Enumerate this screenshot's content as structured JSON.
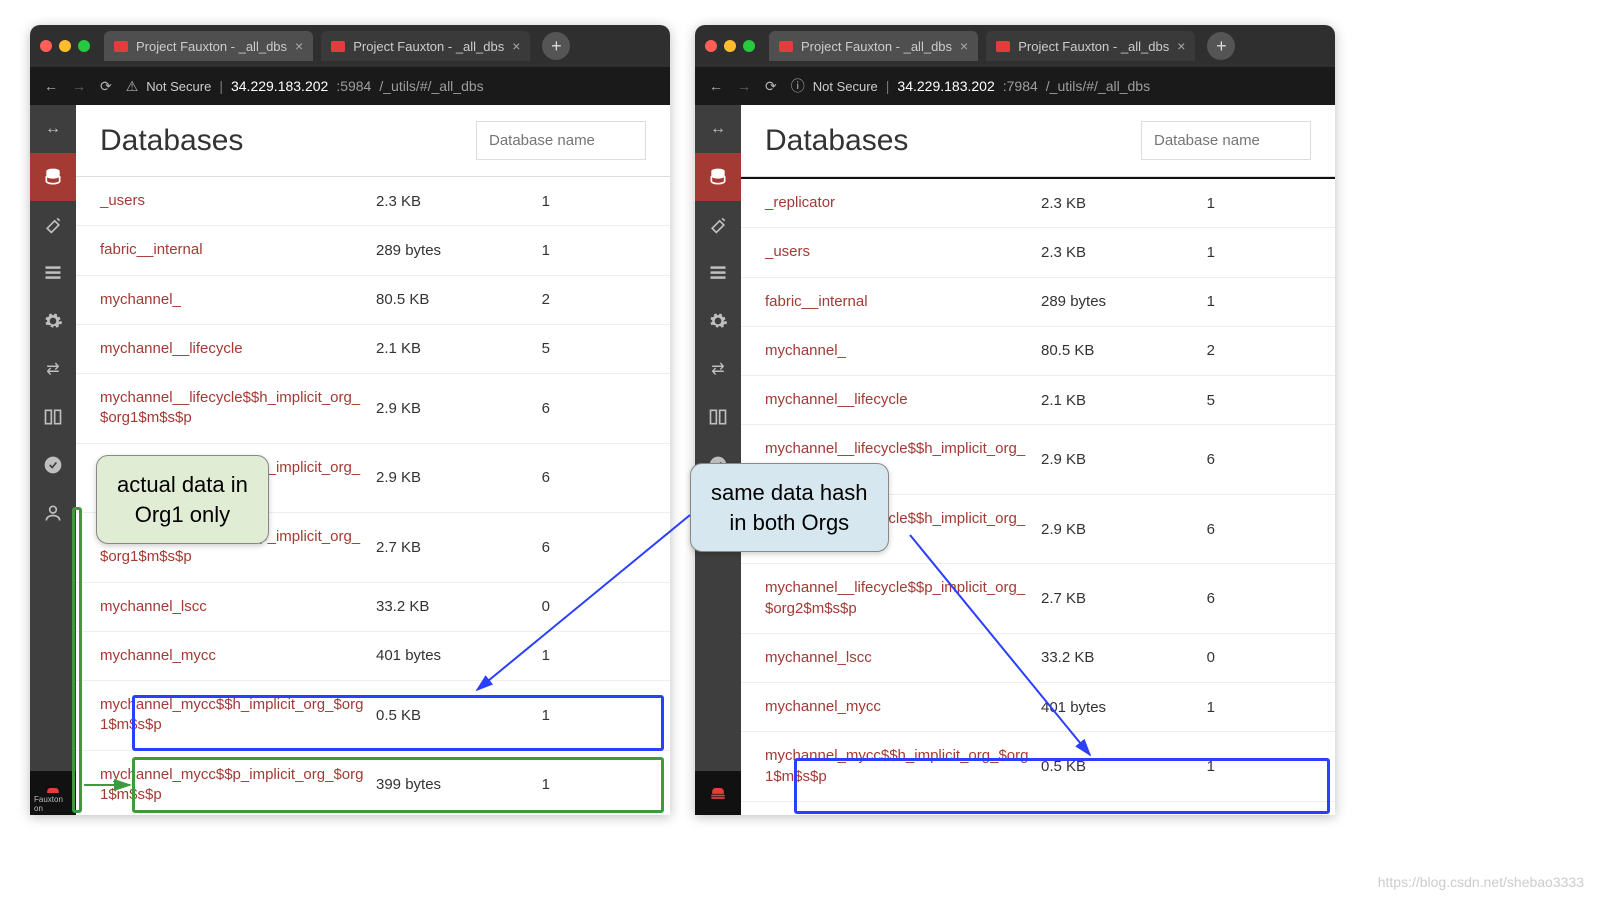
{
  "tabs": {
    "t1": "Project Fauxton - _all_dbs",
    "t2": "Project Fauxton - _all_dbs"
  },
  "notsecure": "Not Secure",
  "addr": {
    "left": {
      "host": "34.229.183.202",
      "port": ":5984",
      "path": "/_utils/#/_all_dbs"
    },
    "right": {
      "host": "34.229.183.202",
      "port": ":7984",
      "path": "/_utils/#/_all_dbs"
    }
  },
  "heading": "Databases",
  "search_ph": "Database name",
  "fx": "Fauxton on",
  "left_rows": [
    {
      "name": "_users",
      "size": "2.3 KB",
      "cnt": "1"
    },
    {
      "name": "fabric__internal",
      "size": "289 bytes",
      "cnt": "1"
    },
    {
      "name": "mychannel_",
      "size": "80.5 KB",
      "cnt": "2"
    },
    {
      "name": "mychannel__lifecycle",
      "size": "2.1 KB",
      "cnt": "5"
    },
    {
      "name": "mychannel__lifecycle$$h_implicit_org_$org1$m$s$p",
      "size": "2.9 KB",
      "cnt": "6"
    },
    {
      "name": "mychannel__lifecycle$$h_implicit_org_$org2$m$s$p",
      "size": "2.9 KB",
      "cnt": "6"
    },
    {
      "name": "mychannel__lifecycle$$p_implicit_org_$org1$m$s$p",
      "size": "2.7 KB",
      "cnt": "6"
    },
    {
      "name": "mychannel_lscc",
      "size": "33.2 KB",
      "cnt": "0"
    },
    {
      "name": "mychannel_mycc",
      "size": "401 bytes",
      "cnt": "1"
    },
    {
      "name": "mychannel_mycc$$h_implicit_org_$org1$m$s$p",
      "size": "0.5 KB",
      "cnt": "1"
    },
    {
      "name": "mychannel_mycc$$p_implicit_org_$org1$m$s$p",
      "size": "399 bytes",
      "cnt": "1"
    }
  ],
  "right_rows": [
    {
      "name": "_replicator",
      "size": "2.3 KB",
      "cnt": "1"
    },
    {
      "name": "_users",
      "size": "2.3 KB",
      "cnt": "1"
    },
    {
      "name": "fabric__internal",
      "size": "289 bytes",
      "cnt": "1"
    },
    {
      "name": "mychannel_",
      "size": "80.5 KB",
      "cnt": "2"
    },
    {
      "name": "mychannel__lifecycle",
      "size": "2.1 KB",
      "cnt": "5"
    },
    {
      "name": "mychannel__lifecycle$$h_implicit_org_$org1$m$s$p",
      "size": "2.9 KB",
      "cnt": "6"
    },
    {
      "name": "mychannel__lifecycle$$h_implicit_org_$org2$m$s$p",
      "size": "2.9 KB",
      "cnt": "6"
    },
    {
      "name": "mychannel__lifecycle$$p_implicit_org_$org2$m$s$p",
      "size": "2.7 KB",
      "cnt": "6"
    },
    {
      "name": "mychannel_lscc",
      "size": "33.2 KB",
      "cnt": "0"
    },
    {
      "name": "mychannel_mycc",
      "size": "401 bytes",
      "cnt": "1"
    },
    {
      "name": "mychannel_mycc$$h_implicit_org_$org1$m$s$p",
      "size": "0.5 KB",
      "cnt": "1"
    }
  ],
  "callouts": {
    "g": "actual data in\nOrg1 only",
    "b": "same data hash\nin both Orgs"
  },
  "watermark": "https://blog.csdn.net/shebao3333"
}
